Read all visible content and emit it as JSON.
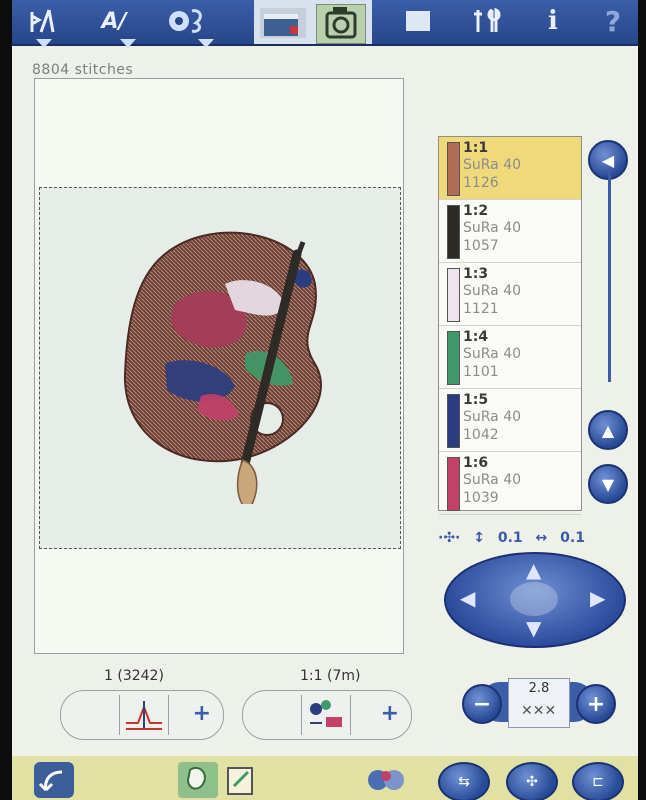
{
  "header": {
    "btn1_icon": "stitch-menu-icon",
    "btn2_label": "A∕",
    "btn3_icon": "embroidery-menu-icon",
    "btn4_icon": "edit-mode-icon",
    "btn5_icon": "stitch-out-icon",
    "btn6_icon": "file-manager-icon",
    "btn7_icon": "settings-icon",
    "btn8_label": "i",
    "btn9_label": "?"
  },
  "stitch_count": "8804 stitches",
  "colors": [
    {
      "index": "1:1",
      "thread": "SuRa 40",
      "number": "1126",
      "hex": "#b06e55",
      "selected": true
    },
    {
      "index": "1:2",
      "thread": "SuRa 40",
      "number": "1057",
      "hex": "#2e2a26",
      "selected": false
    },
    {
      "index": "1:3",
      "thread": "SuRa 40",
      "number": "1121",
      "hex": "#ece4ee",
      "selected": false
    },
    {
      "index": "1:4",
      "thread": "SuRa 40",
      "number": "1101",
      "hex": "#3e9a68",
      "selected": false
    },
    {
      "index": "1:5",
      "thread": "SuRa 40",
      "number": "1042",
      "hex": "#2b3d80",
      "selected": false
    },
    {
      "index": "1:6",
      "thread": "SuRa 40",
      "number": "1039",
      "hex": "#c2406a",
      "selected": false
    }
  ],
  "move": {
    "vertical_step": "0.1",
    "horizontal_step": "0.1",
    "vertical_symbol": "↕",
    "horizontal_symbol": "↔"
  },
  "stitch_width": {
    "value": "2.8"
  },
  "stitch_position": {
    "label": "1 (3242)"
  },
  "color_position": {
    "label": "1:1 (7m)"
  },
  "accent": "#3a5ea8"
}
